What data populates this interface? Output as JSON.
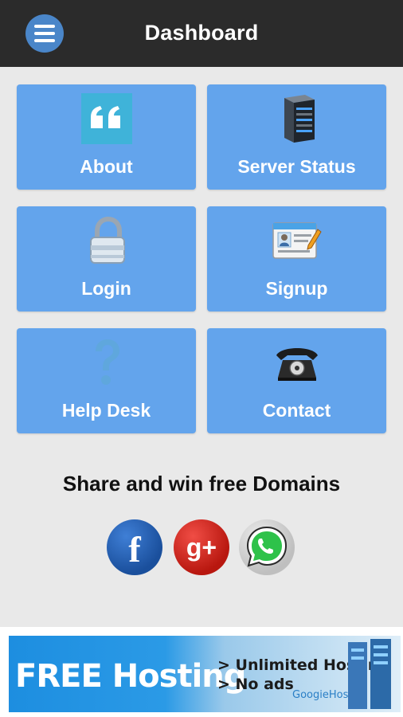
{
  "header": {
    "title": "Dashboard",
    "menu_icon": "hamburger-icon"
  },
  "tiles": [
    {
      "label": "About",
      "icon": "quote-icon"
    },
    {
      "label": "Server Status",
      "icon": "server-icon"
    },
    {
      "label": "Login",
      "icon": "padlock-icon"
    },
    {
      "label": "Signup",
      "icon": "id-card-icon"
    },
    {
      "label": "Help Desk",
      "icon": "question-mark-icon"
    },
    {
      "label": "Contact",
      "icon": "telephone-icon"
    }
  ],
  "share": {
    "title": "Share and win free Domains",
    "facebook_glyph": "f",
    "googleplus_glyph": "g+"
  },
  "banner": {
    "headline": "FREE Hosting",
    "line1": "> Unlimited Hosting",
    "line2": "> No ads",
    "brand": "GoogieHost"
  },
  "colors": {
    "topbar": "#2b2b2b",
    "tile": "#63a4ec",
    "background": "#e9e9e9",
    "menu_button": "#4a86c9"
  }
}
